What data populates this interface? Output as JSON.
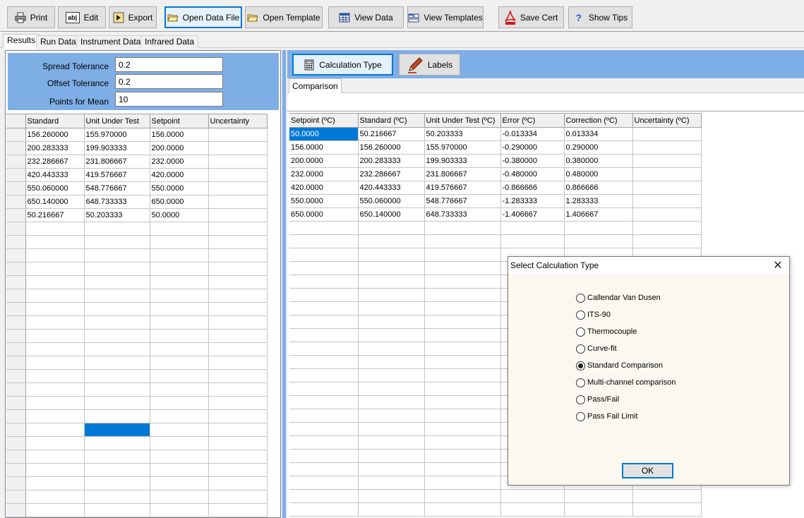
{
  "toolbar": {
    "print": "Print",
    "edit": "Edit",
    "export": "Export",
    "open_data_file": "Open Data File",
    "open_template": "Open Template",
    "view_data": "View Data",
    "view_templates": "View Templates",
    "save_cert": "Save Cert",
    "show_tips": "Show Tips",
    "edit_icon_text": "ab|"
  },
  "left_tabs": [
    "Results",
    "Run Data",
    "Instrument Data",
    "Infrared Data"
  ],
  "params": {
    "spread_label": "Spread Tolerance",
    "spread_value": "0.2",
    "offset_label": "Offset Tolerance",
    "offset_value": "0.2",
    "points_label": "Points for Mean",
    "points_value": "10"
  },
  "left_grid": {
    "headers": [
      "Standard",
      "Unit Under Test",
      "Setpoint",
      "Uncertainty"
    ],
    "rows": [
      [
        "156.260000",
        "155.970000",
        "156.0000",
        ""
      ],
      [
        "200.283333",
        "199.903333",
        "200.0000",
        ""
      ],
      [
        "232.286667",
        "231.806667",
        "232.0000",
        ""
      ],
      [
        "420.443333",
        "419.576667",
        "420.0000",
        ""
      ],
      [
        "550.060000",
        "548.776667",
        "550.0000",
        ""
      ],
      [
        "650.140000",
        "648.733333",
        "650.0000",
        ""
      ],
      [
        "50.216667",
        "50.203333",
        "50.0000",
        ""
      ]
    ]
  },
  "right_toolbar": {
    "calc_type": "Calculation Type",
    "labels": "Labels"
  },
  "comparison_tab": "Comparison",
  "right_grid": {
    "headers": [
      "Setpoint (ºC)",
      "Standard (ºC)",
      "Unit Under Test (ºC)",
      "Error (ºC)",
      "Correction (ºC)",
      "Uncertainty (ºC)"
    ],
    "rows": [
      [
        "50.0000",
        "50.216667",
        "50.203333",
        "-0.013334",
        "0.013334",
        ""
      ],
      [
        "156.0000",
        "156.260000",
        "155.970000",
        "-0.290000",
        "0.290000",
        ""
      ],
      [
        "200.0000",
        "200.283333",
        "199.903333",
        "-0.380000",
        "0.380000",
        ""
      ],
      [
        "232.0000",
        "232.286667",
        "231.806667",
        "-0.480000",
        "0.480000",
        ""
      ],
      [
        "420.0000",
        "420.443333",
        "419.576667",
        "-0.866666",
        "0.866666",
        ""
      ],
      [
        "550.0000",
        "550.060000",
        "548.776667",
        "-1.283333",
        "1.283333",
        ""
      ],
      [
        "650.0000",
        "650.140000",
        "648.733333",
        "-1.406667",
        "1.406667",
        ""
      ]
    ]
  },
  "dialog": {
    "title": "Select Calculation Type",
    "options": [
      "Callendar Van Dusen",
      "ITS-90",
      "Thermocouple",
      "Curve-fit",
      "Standard Comparison",
      "Multi-channel comparison",
      "Pass/Fail",
      "Pass Fail Limit"
    ],
    "selected": "Standard Comparison",
    "ok": "OK"
  },
  "colors": {
    "accent_blue": "#7eaee6",
    "selection_blue": "#0078d7"
  }
}
